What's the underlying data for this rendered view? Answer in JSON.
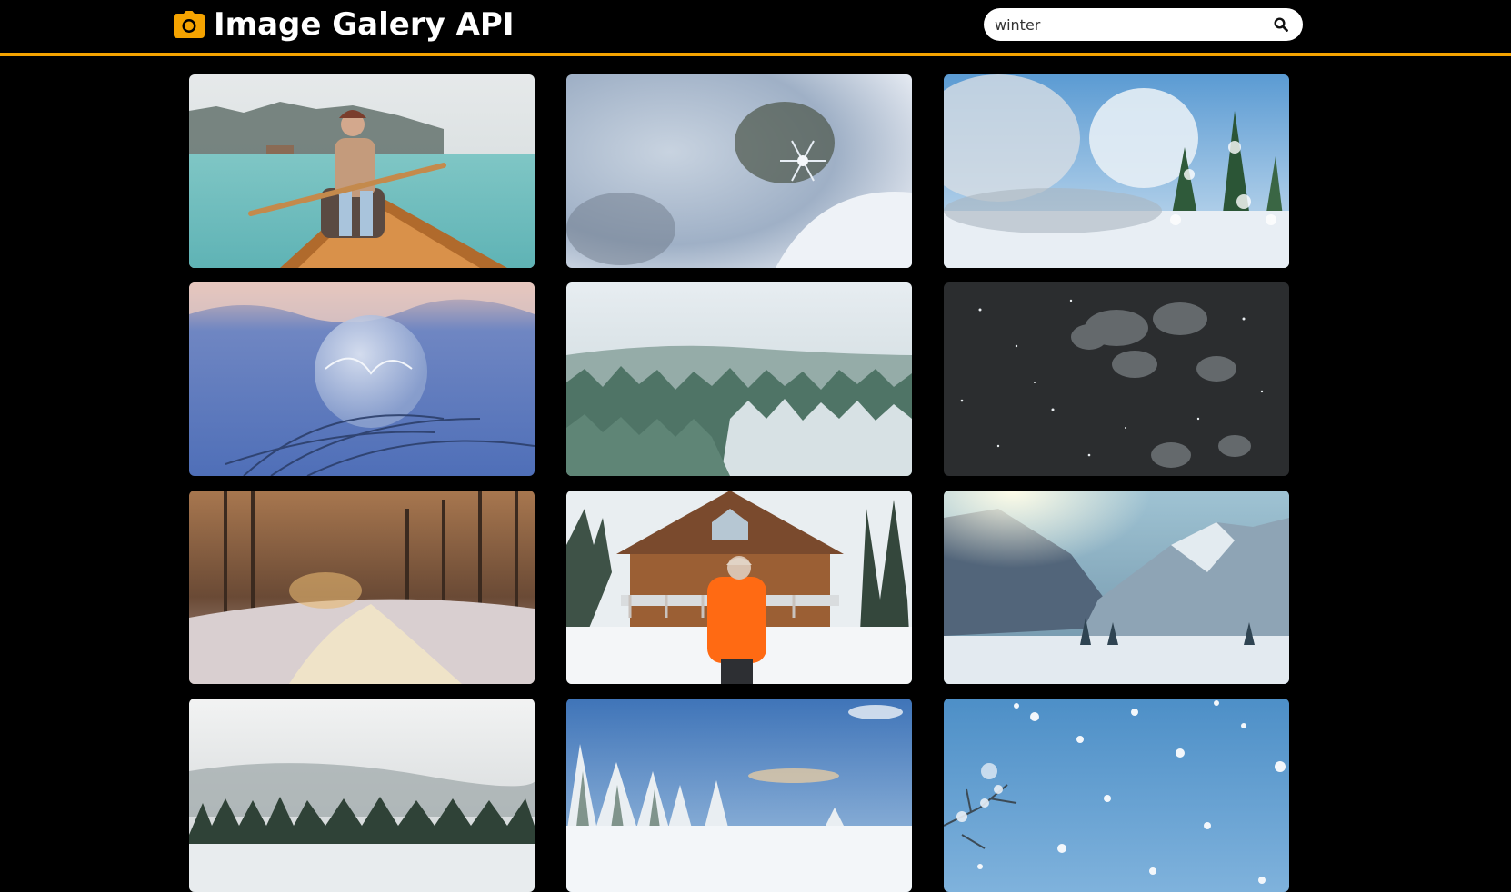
{
  "header": {
    "title": "Image Galery API",
    "logo_icon": "camera-icon",
    "accent_color": "#f5a300"
  },
  "search": {
    "value": "winter",
    "icon": "search-icon"
  },
  "gallery": {
    "images": [
      {
        "subject": "woman-in-canoe-on-lake"
      },
      {
        "subject": "snowflake-closeup"
      },
      {
        "subject": "snowy-trees-blue-sky"
      },
      {
        "subject": "frozen-bubble"
      },
      {
        "subject": "frosted-forest-aerial"
      },
      {
        "subject": "falling-snow-dark"
      },
      {
        "subject": "snowy-forest-road-sunset"
      },
      {
        "subject": "woman-orange-jacket-log-cabin"
      },
      {
        "subject": "snowy-mountain-valley"
      },
      {
        "subject": "misty-forest-lake"
      },
      {
        "subject": "snowy-pines-blue-sky"
      },
      {
        "subject": "snowflakes-blue-sky-branch"
      }
    ]
  }
}
